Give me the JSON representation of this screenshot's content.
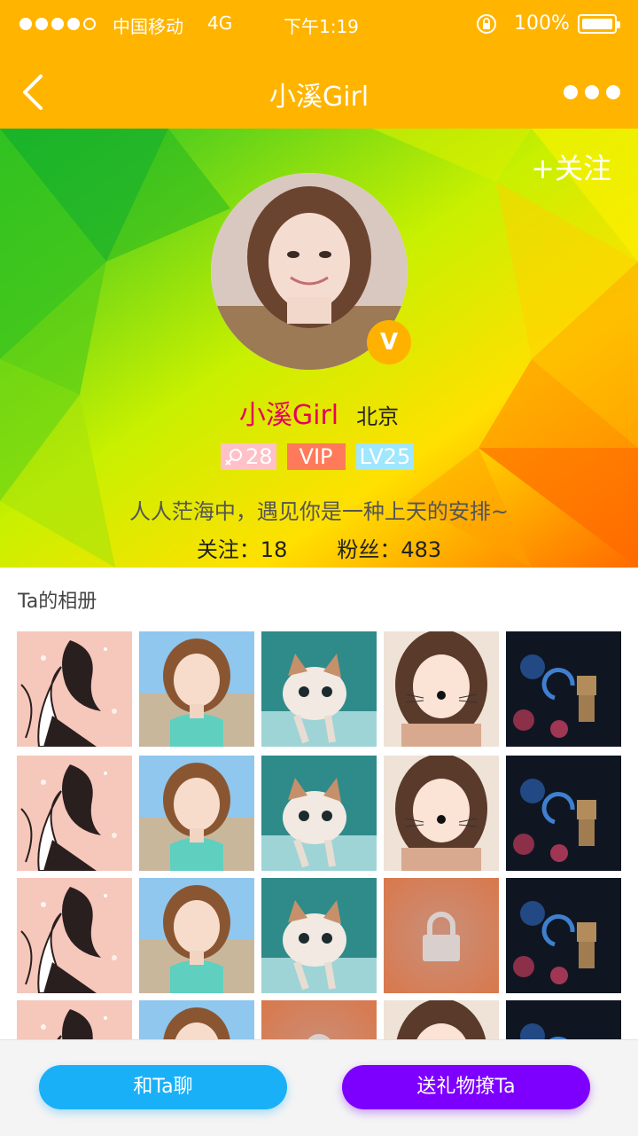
{
  "status_bar": {
    "carrier": "中国移动",
    "network": "4G",
    "time": "下午1:19",
    "battery": "100%"
  },
  "nav": {
    "title": "小溪Girl",
    "back_icon": "chevron-left-icon",
    "more_icon": "more-dots-icon"
  },
  "profile": {
    "follow_label": "+关注",
    "name": "小溪Girl",
    "city": "北京",
    "age": "28",
    "vip": "VIP",
    "level": "LV25",
    "bio": "人人茫海中，遇见你是一种上天的安排~",
    "following_label": "关注：18",
    "fans_label": "粉丝：483",
    "verified_badge": "V"
  },
  "album": {
    "title": "Ta的相册",
    "locked_icon": "lock-icon"
  },
  "actions": {
    "chat_label": "和Ta聊",
    "gift_label": "送礼物撩Ta"
  },
  "colors": {
    "nav_bg": "#ffb400",
    "name": "#e6005e",
    "vip": "#ff7a5a",
    "level": "#9fe6ff",
    "chat_button": "#1ab0f8",
    "gift_button": "#7d00ff"
  }
}
